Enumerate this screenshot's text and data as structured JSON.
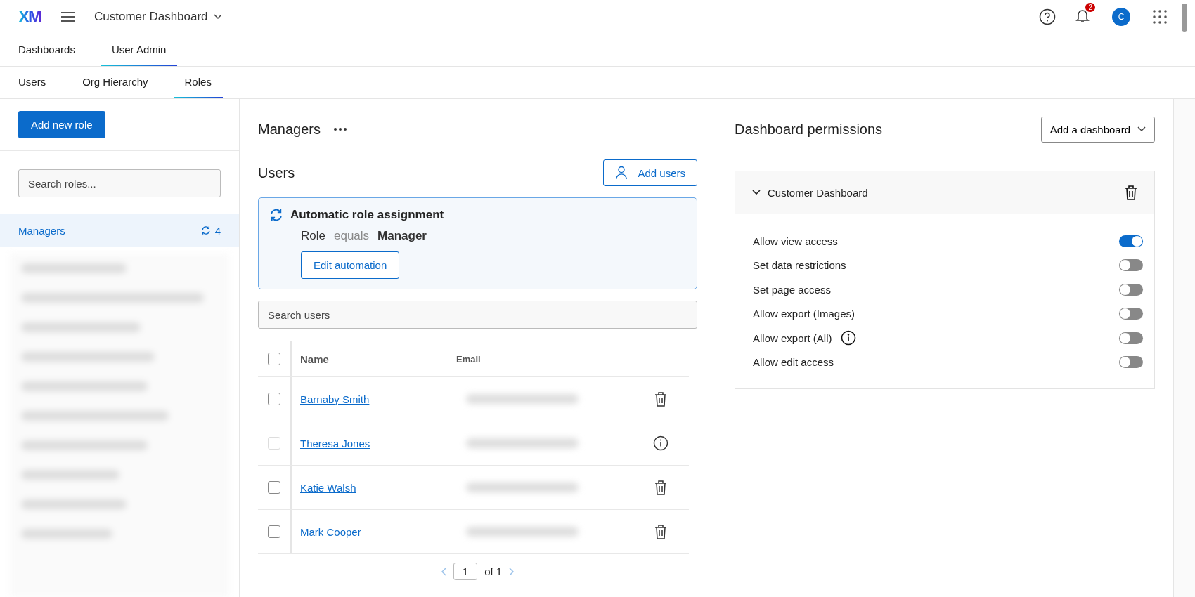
{
  "app_bar": {
    "logo": "XM",
    "title": "Customer Dashboard",
    "notification_count": "2",
    "avatar": "C"
  },
  "main_tabs": [
    {
      "label": "Dashboards",
      "selected": false
    },
    {
      "label": "User Admin",
      "selected": true
    }
  ],
  "sub_tabs": [
    {
      "label": "Users",
      "selected": false
    },
    {
      "label": "Org Hierarchy",
      "selected": false
    },
    {
      "label": "Roles",
      "selected": true
    }
  ],
  "roles_panel": {
    "add_button": "Add new role",
    "search": {
      "placeholder": "Search roles..."
    },
    "roles": [
      {
        "name": "Managers",
        "count": "4",
        "selected": true
      }
    ]
  },
  "role_detail": {
    "title": "Managers",
    "users_heading": "Users",
    "add_users_button": "Add users",
    "automation": {
      "title": "Automatic role assignment",
      "field": "Role",
      "operator": "equals",
      "value": "Manager",
      "button": "Edit automation"
    },
    "search": {
      "placeholder": "Search users"
    },
    "table": {
      "columns": [
        "Name",
        "Email"
      ],
      "header_checked": false,
      "rows": [
        {
          "name": "Barnaby Smith",
          "checked": false,
          "disabled": false,
          "kind": "delete"
        },
        {
          "name": "Theresa Jones",
          "checked": false,
          "disabled": true,
          "kind": "info"
        },
        {
          "name": "Katie Walsh",
          "checked": false,
          "disabled": false,
          "kind": "delete"
        },
        {
          "name": "Mark Cooper",
          "checked": false,
          "disabled": false,
          "kind": "delete"
        }
      ]
    },
    "pagination": {
      "page": "1",
      "of": "of 1"
    }
  },
  "permissions": {
    "title": "Dashboard permissions",
    "add_button": "Add a dashboard",
    "dashboards": [
      {
        "name": "Customer Dashboard",
        "expanded": true,
        "settings": [
          {
            "label": "Allow view access",
            "on": true,
            "info": false
          },
          {
            "label": "Set data restrictions",
            "on": false,
            "info": false
          },
          {
            "label": "Set page access",
            "on": false,
            "info": false
          },
          {
            "label": "Allow export (Images)",
            "on": false,
            "info": false
          },
          {
            "label": "Allow export (All)",
            "on": false,
            "info": true
          },
          {
            "label": "Allow edit access",
            "on": false,
            "info": false
          }
        ]
      }
    ]
  }
}
